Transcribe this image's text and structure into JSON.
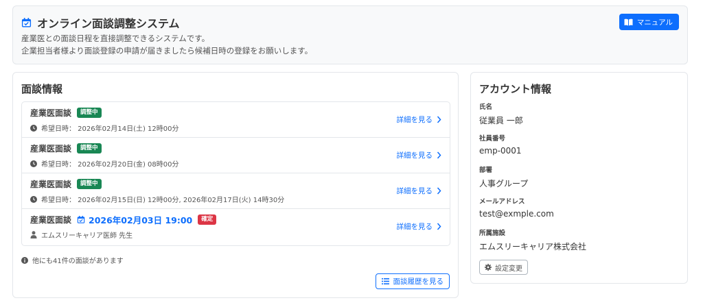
{
  "header": {
    "title": "オンライン面談調整システム",
    "desc_line1": "産業医との面談日程を直接調整できるシステムです。",
    "desc_line2": "企業担当者様より面談登録の申請が届きましたら候補日時の登録をお願いします。",
    "manual_label": "マニュアル",
    "icon": "calendar-check-icon"
  },
  "interviews": {
    "title": "面談情報",
    "items": [
      {
        "name": "産業医面談",
        "badge": "調整中",
        "sub": "希望日時： 2026年02月14日(土) 12時00分",
        "link": "詳細を見る"
      },
      {
        "name": "産業医面談",
        "badge": "調整中",
        "sub": "希望日時： 2026年02月20日(金) 08時00分",
        "link": "詳細を見る"
      },
      {
        "name": "産業医面談",
        "badge": "調整中",
        "sub": "希望日時： 2026年02月15日(日) 12時00分, 2026年02月17日(火) 14時30分",
        "link": "詳細を見る"
      },
      {
        "name": "産業医面談",
        "date": "2026年02月03日 19:00",
        "badge": "確定",
        "sub": "エムスリーキャリア医師 先生",
        "link": "詳細を見る"
      }
    ],
    "others_text": "他にも41件の面談があります",
    "history_label": "面談履歴を見る"
  },
  "account": {
    "title": "アカウント情報",
    "fields": [
      {
        "label": "氏名",
        "value": "従業員 一郎"
      },
      {
        "label": "社員番号",
        "value": "emp-0001"
      },
      {
        "label": "部署",
        "value": "人事グループ"
      },
      {
        "label": "メールアドレス",
        "value": "test@exmple.com"
      },
      {
        "label": "所属施設",
        "value": "エムスリーキャリア株式会社"
      }
    ],
    "settings_label": "設定変更"
  },
  "colors": {
    "primary": "#0d6efd",
    "badge_adjusting": "#198754",
    "badge_confirmed": "#dc3545"
  }
}
